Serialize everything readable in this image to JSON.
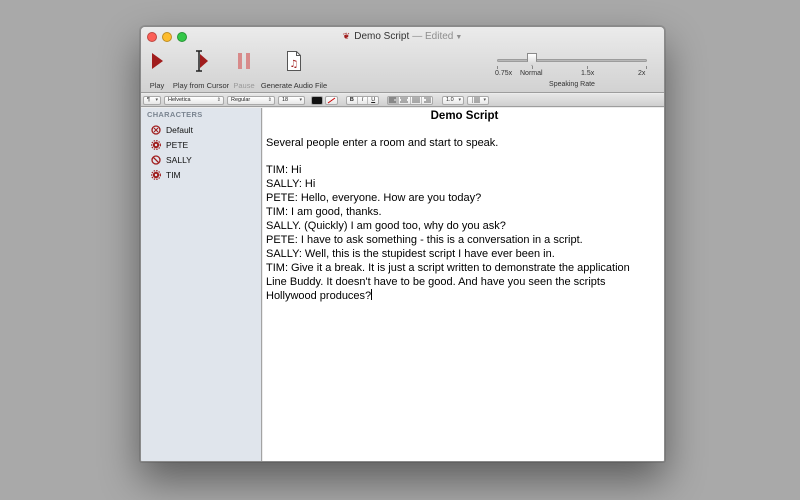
{
  "window": {
    "title": "Demo Script",
    "status": "— Edited"
  },
  "toolbar": {
    "play_label": "Play",
    "play_from_cursor_label": "Play from Cursor",
    "pause_label": "Pause",
    "generate_audio_label": "Generate Audio File",
    "speaking_rate": {
      "caption": "Speaking Rate",
      "ticks": [
        "0.75x",
        "Normal",
        "1.5x",
        "2x"
      ],
      "value": "Normal"
    }
  },
  "format_bar": {
    "style_menu": "¶",
    "font_family": "Helvetica",
    "font_style": "Regular",
    "font_size": "18",
    "bold": "B",
    "italic": "I",
    "underline": "U",
    "line_spacing": "1.0"
  },
  "sidebar": {
    "header": "CHARACTERS",
    "characters": [
      {
        "name": "Default",
        "icon": "default-voice-icon"
      },
      {
        "name": "PETE",
        "icon": "gear-voice-icon"
      },
      {
        "name": "SALLY",
        "icon": "muted-voice-icon"
      },
      {
        "name": "TIM",
        "icon": "gear-voice-icon"
      }
    ]
  },
  "document": {
    "title": "Demo Script",
    "intro": "Several people enter a room and start to speak.",
    "lines": [
      "TIM: Hi",
      "SALLY: Hi",
      "PETE: Hello, everyone. How are you today?",
      "TIM: I am good, thanks.",
      "SALLY. (Quickly) I am good too, why do you ask?",
      "PETE: I have to ask something - this is a conversation in a script.",
      "SALLY: Well, this is the stupidest script I have ever been in.",
      "TIM: Give it a break. It is just a script written to demonstrate the application",
      "Line Buddy. It doesn't have to be good. And have you seen the scripts",
      "Hollywood produces?"
    ]
  },
  "colors": {
    "accent": "#a01c1c",
    "pause_disabled": "#d88a8a",
    "sidebar_bg": "#e0e5ec"
  }
}
